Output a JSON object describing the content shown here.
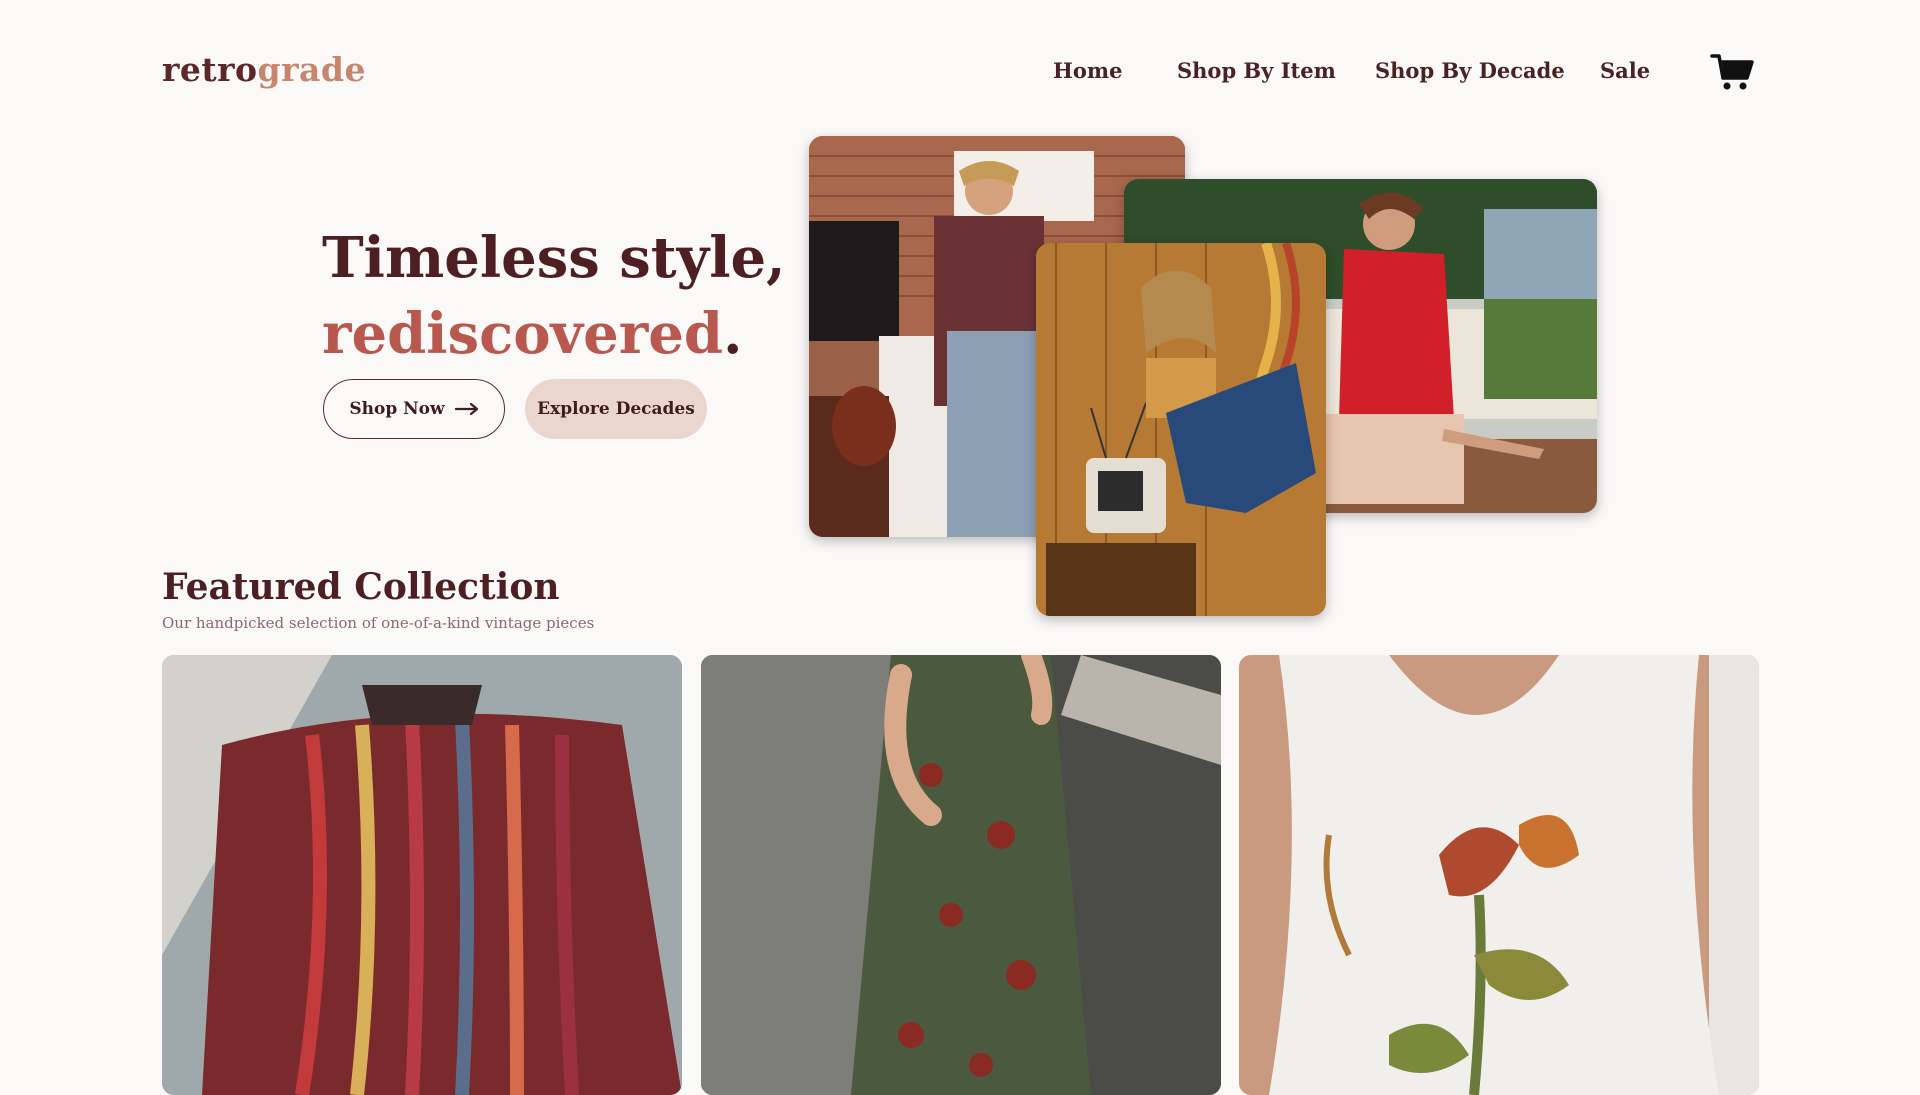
{
  "brand": {
    "part1": "retro",
    "part2": "grade"
  },
  "nav": {
    "items": [
      {
        "label": "Home"
      },
      {
        "label": "Shop By Item"
      },
      {
        "label": "Shop By Decade"
      },
      {
        "label": "Sale"
      }
    ],
    "cart_icon": "cart-icon"
  },
  "hero": {
    "title_line1": "Timeless style,",
    "title_line2": "rediscovered",
    "title_period": ".",
    "shop_now": "Shop Now",
    "shop_now_icon": "arrow-right-icon",
    "explore": "Explore Decades"
  },
  "featured": {
    "title": "Featured Collection",
    "subtitle": "Our handpicked selection of one-of-a-kind vintage pieces"
  },
  "colors": {
    "background": "#fbf9f8",
    "brand_dark": "#5b2727",
    "brand_accent": "#c8856e",
    "hero_accent": "#b8584f",
    "explore_bg": "#ead6cd"
  }
}
